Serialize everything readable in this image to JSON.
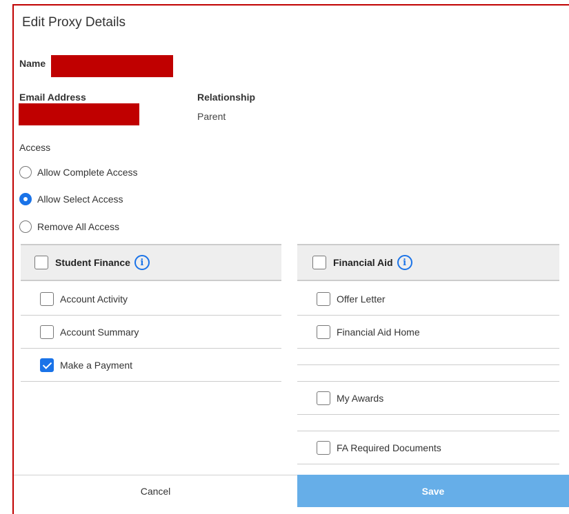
{
  "dialog": {
    "title": "Edit Proxy Details"
  },
  "fields": {
    "name_label": "Name",
    "email_label": "Email Address",
    "relationship_label": "Relationship",
    "relationship_value": "Parent",
    "access_label": "Access"
  },
  "access_options": [
    {
      "label": "Allow Complete Access",
      "selected": false
    },
    {
      "label": "Allow Select Access",
      "selected": true
    },
    {
      "label": "Remove All Access",
      "selected": false
    }
  ],
  "sections": {
    "student_finance": {
      "label": "Student Finance",
      "checked": false,
      "items": [
        {
          "label": "Account Activity",
          "checked": false
        },
        {
          "label": "Account Summary",
          "checked": false
        },
        {
          "label": "Make a Payment",
          "checked": true
        }
      ]
    },
    "financial_aid": {
      "label": "Financial Aid",
      "checked": false,
      "items": [
        {
          "label": "Offer Letter",
          "checked": false
        },
        {
          "label": "Financial Aid Home",
          "checked": false
        },
        {
          "label": "My Awards",
          "checked": false
        },
        {
          "label": "FA Required Documents",
          "checked": false
        }
      ]
    }
  },
  "buttons": {
    "cancel": "Cancel",
    "save": "Save"
  },
  "colors": {
    "redaction": "#c00000",
    "accent": "#1a73e8",
    "save_button": "#66aee8"
  }
}
